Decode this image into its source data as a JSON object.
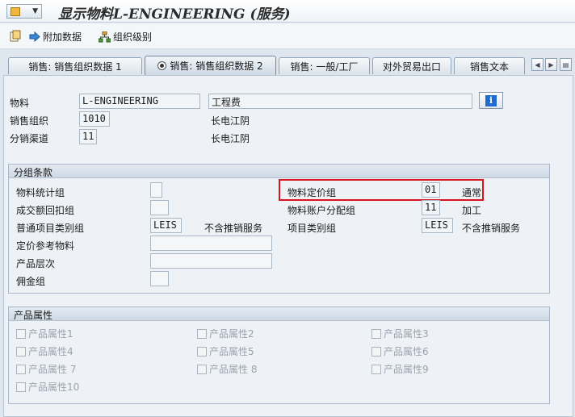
{
  "window": {
    "title": "显示物料L-ENGINEERING (服务)"
  },
  "toolbar": {
    "additional_data_label": "附加数据",
    "org_levels_label": "组织级别"
  },
  "tabs": [
    {
      "label": "销售: 销售组织数据 1",
      "active": false
    },
    {
      "label": "销售: 销售组织数据 2",
      "active": true
    },
    {
      "label": "销售: 一般/工厂",
      "active": false
    },
    {
      "label": "对外贸易出口",
      "active": false
    },
    {
      "label": "销售文本",
      "active": false
    }
  ],
  "header": {
    "material_label": "物料",
    "material_value": "L-ENGINEERING",
    "material_desc": "工程费",
    "sales_org_label": "销售组织",
    "sales_org_value": "1010",
    "sales_org_desc": "长电江阴",
    "dist_channel_label": "分销渠道",
    "dist_channel_value": "11",
    "dist_channel_desc": "长电江阴"
  },
  "grouping": {
    "title": "分组条款",
    "material_stat_group_label": "物料统计组",
    "material_stat_group_value": "",
    "rebate_group_label": "成交额回扣组",
    "rebate_group_value": "",
    "gen_item_cat_group_label": "普通项目类别组",
    "gen_item_cat_group_value": "LEIS",
    "gen_item_cat_group_desc": "不含推销服务",
    "pricing_ref_material_label": "定价参考物料",
    "pricing_ref_material_value": "",
    "product_hierarchy_label": "产品层次",
    "product_hierarchy_value": "",
    "commission_group_label": "佣金组",
    "commission_group_value": "",
    "material_pricing_group_label": "物料定价组",
    "material_pricing_group_value": "01",
    "material_pricing_group_desc": "通常",
    "acct_assignment_group_label": "物料账户分配组",
    "acct_assignment_group_value": "11",
    "acct_assignment_group_desc": "加工",
    "item_cat_group_label": "项目类别组",
    "item_cat_group_value": "LEIS",
    "item_cat_group_desc": "不含推销服务"
  },
  "product_attributes": {
    "title": "产品属性",
    "items": [
      "产品属性1",
      "产品属性2",
      "产品属性3",
      "产品属性4",
      "产品属性5",
      "产品属性6",
      "产品属性 7",
      "产品属性 8",
      "产品属性9",
      "产品属性10"
    ]
  },
  "colors": {
    "highlight": "#d9141e",
    "info_icon": "#1e6bd0"
  }
}
